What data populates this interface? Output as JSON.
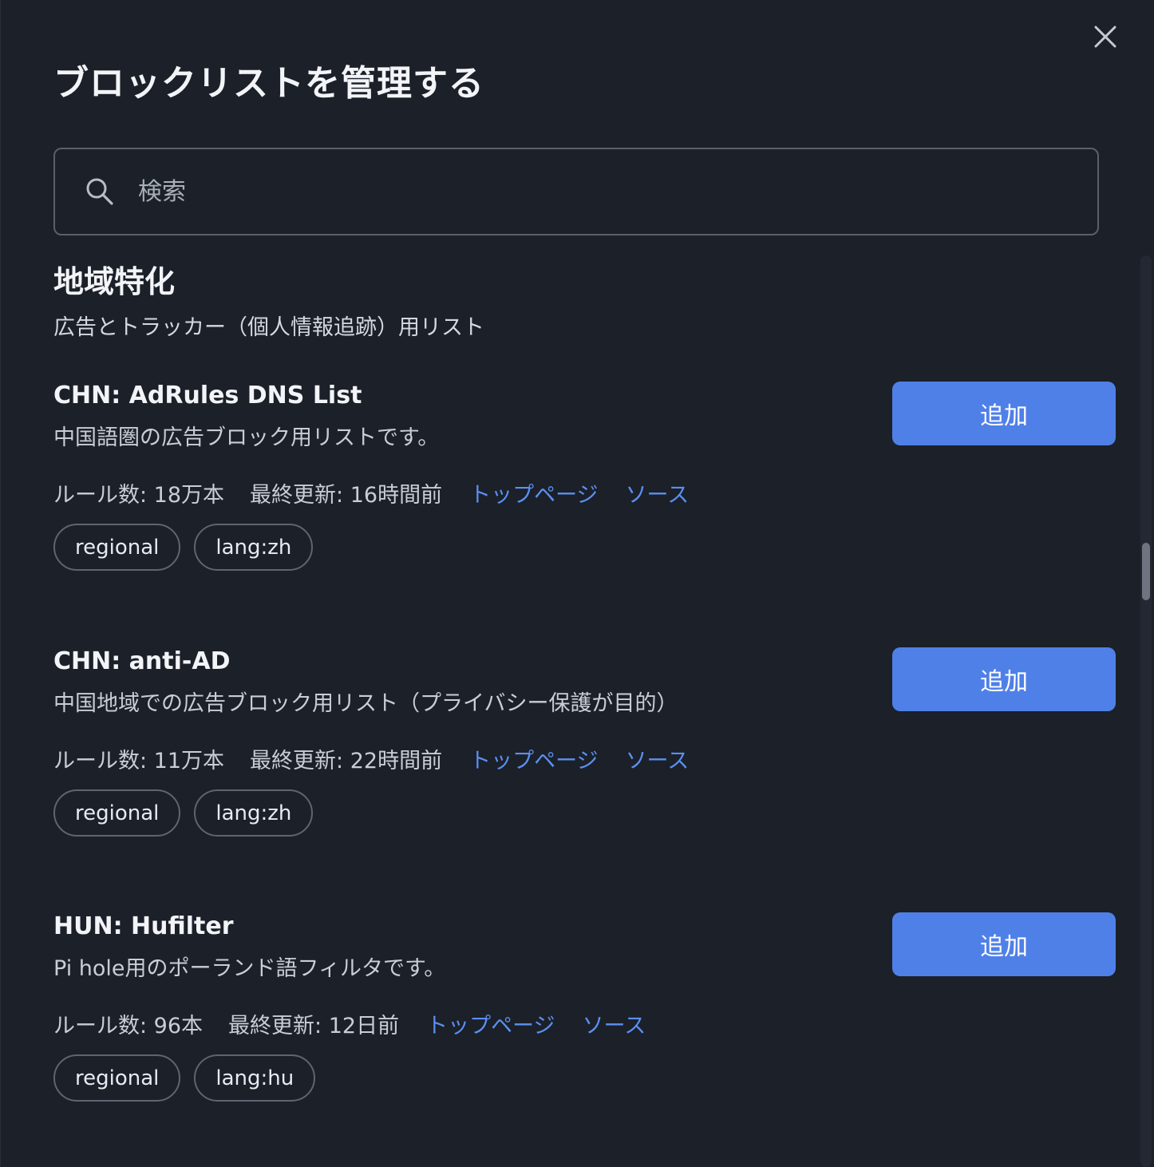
{
  "dialog": {
    "title": "ブロックリストを管理する"
  },
  "search": {
    "placeholder": "検索",
    "value": ""
  },
  "section": {
    "title": "地域特化",
    "description": "広告とトラッカー（個人情報追跡）用リスト"
  },
  "items": [
    {
      "name": "CHN: AdRules DNS List",
      "description": "中国語圏の広告ブロック用リストです。",
      "rules": "ルール数: 18万本",
      "updated": "最終更新: 16時間前",
      "homepage_label": "トップページ",
      "source_label": "ソース",
      "tags": [
        "regional",
        "lang:zh"
      ],
      "button_label": "追加"
    },
    {
      "name": "CHN: anti-AD",
      "description": "中国地域での広告ブロック用リスト（プライバシー保護が目的）",
      "rules": "ルール数: 11万本",
      "updated": "最終更新: 22時間前",
      "homepage_label": "トップページ",
      "source_label": "ソース",
      "tags": [
        "regional",
        "lang:zh"
      ],
      "button_label": "追加"
    },
    {
      "name": "HUN: Hufilter",
      "description": "Pi hole用のポーランド語フィルタです。",
      "rules": "ルール数: 96本",
      "updated": "最終更新: 12日前",
      "homepage_label": "トップページ",
      "source_label": "ソース",
      "tags": [
        "regional",
        "lang:hu"
      ],
      "button_label": "追加"
    }
  ],
  "colors": {
    "background": "#1b2029",
    "accent_button": "#4f80e8",
    "link": "#5b8ff0",
    "border": "#5a606b"
  },
  "icons": {
    "close": "close-icon",
    "search": "search-icon"
  }
}
